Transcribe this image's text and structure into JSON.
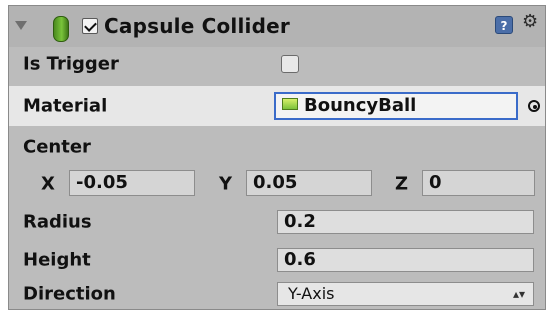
{
  "component": {
    "title": "Capsule Collider",
    "enabled": true,
    "icons": {
      "foldout": "foldout-triangle-icon",
      "capsule": "capsule-collider-icon",
      "help": "help-icon",
      "settings": "gear-icon"
    }
  },
  "properties": {
    "is_trigger": {
      "label": "Is Trigger",
      "checked": false
    },
    "material": {
      "label": "Material",
      "value": "BouncyBall",
      "picker_icon": "object-picker-icon"
    },
    "center": {
      "label": "Center",
      "x_label": "X",
      "x_value": "-0.05",
      "y_label": "Y",
      "y_value": "0.05",
      "z_label": "Z",
      "z_value": "0"
    },
    "radius": {
      "label": "Radius",
      "value": "0.2"
    },
    "height": {
      "label": "Height",
      "value": "0.6"
    },
    "direction": {
      "label": "Direction",
      "value": "Y-Axis"
    }
  }
}
